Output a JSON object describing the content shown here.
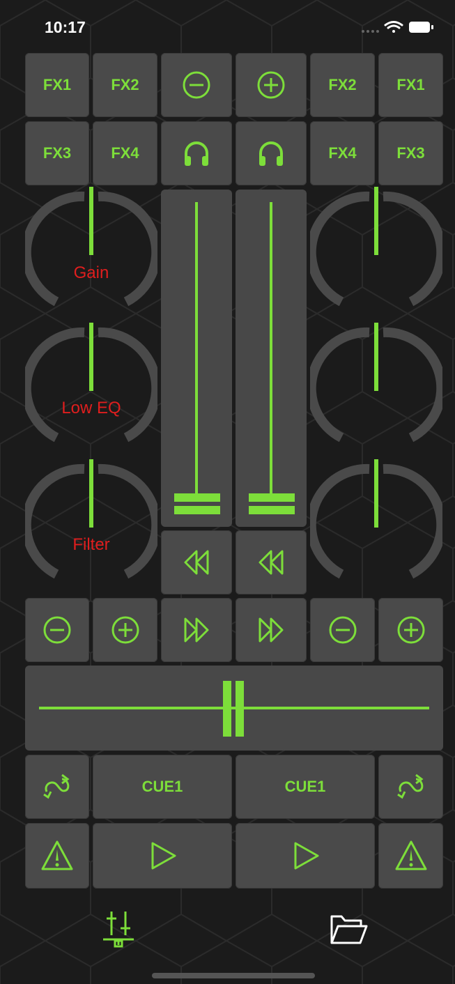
{
  "status_bar": {
    "time": "10:17"
  },
  "colors": {
    "accent": "#7dde3a",
    "label": "#e01e1e",
    "button": "#4a4a4a",
    "background": "#1b1b1b"
  },
  "top_rows": {
    "row1": [
      "FX1",
      "FX2",
      "minus-icon",
      "plus-icon",
      "FX2",
      "FX1"
    ],
    "row2": [
      "FX3",
      "FX4",
      "headphones-icon",
      "headphones-icon",
      "FX4",
      "FX3"
    ]
  },
  "knobs": {
    "left_labels": [
      "Gain",
      "Low EQ",
      "Filter"
    ]
  },
  "mid_row": [
    "minus-icon",
    "plus-icon",
    "fast-forward-icon",
    "fast-forward-icon",
    "minus-icon",
    "plus-icon"
  ],
  "cue_row": {
    "left_cue": "CUE1",
    "right_cue": "CUE1"
  },
  "tabbar": [
    "mixer-icon",
    "folder-icon"
  ]
}
